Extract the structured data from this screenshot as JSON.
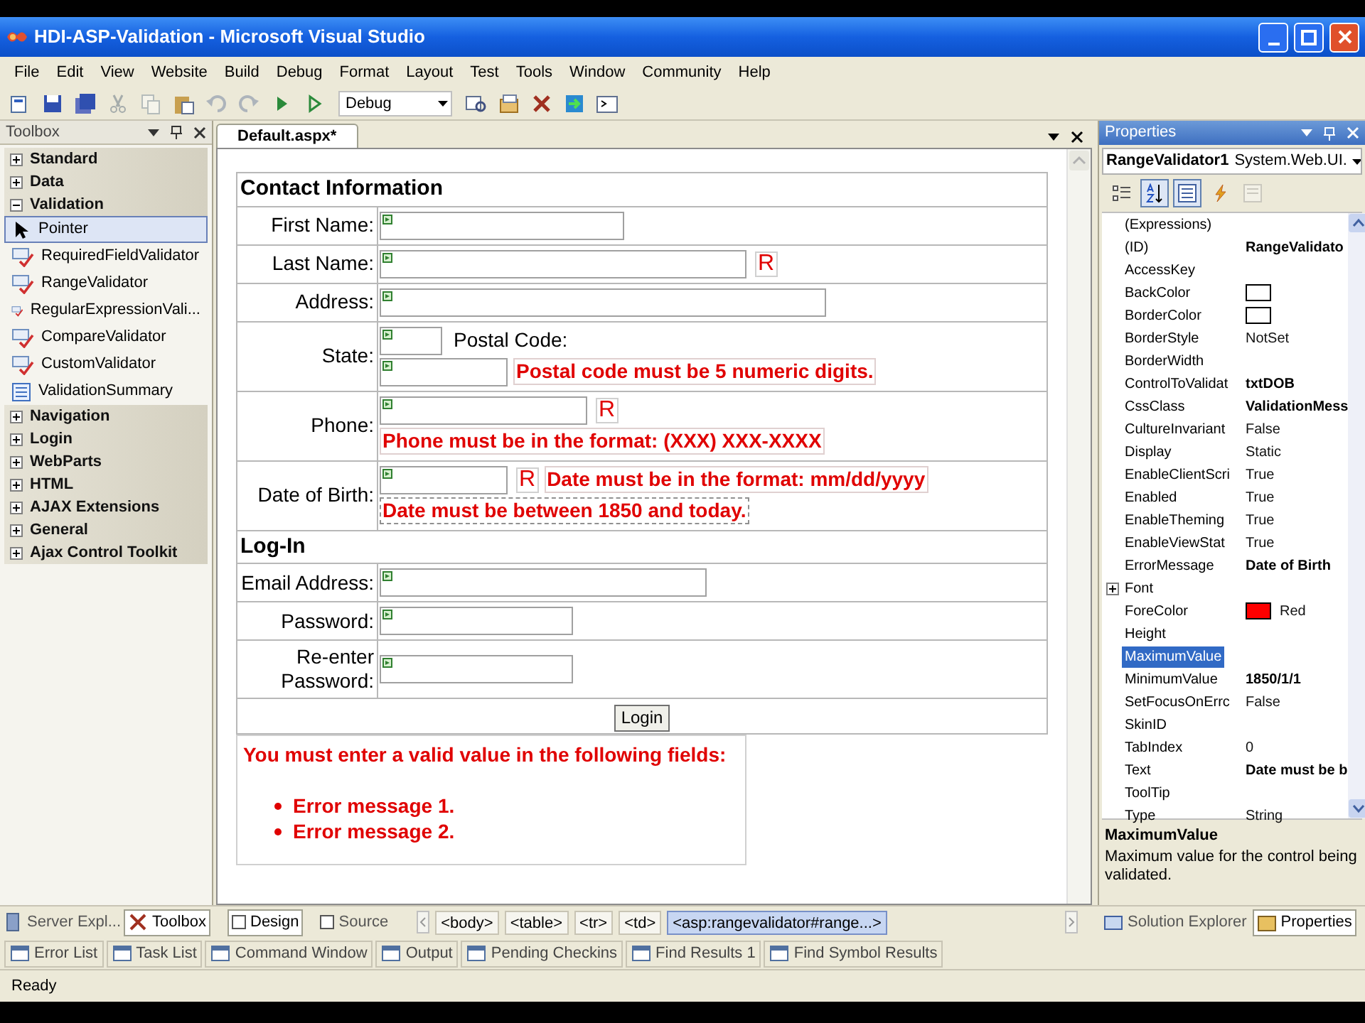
{
  "window": {
    "title": "HDI-ASP-Validation - Microsoft Visual Studio"
  },
  "menu": [
    "File",
    "Edit",
    "View",
    "Website",
    "Build",
    "Debug",
    "Format",
    "Layout",
    "Test",
    "Tools",
    "Window",
    "Community",
    "Help"
  ],
  "toolbar": {
    "configuration": "Debug"
  },
  "toolbox": {
    "title": "Toolbox",
    "categories": [
      {
        "label": "Standard",
        "expanded": false
      },
      {
        "label": "Data",
        "expanded": false
      },
      {
        "label": "Validation",
        "expanded": true,
        "items": [
          {
            "label": "Pointer",
            "kind": "pointer",
            "selected": true
          },
          {
            "label": "RequiredFieldValidator",
            "kind": "validator",
            "selected": false
          },
          {
            "label": "RangeValidator",
            "kind": "validator",
            "selected": false
          },
          {
            "label": "RegularExpressionVali...",
            "kind": "validator",
            "selected": false
          },
          {
            "label": "CompareValidator",
            "kind": "validator",
            "selected": false
          },
          {
            "label": "CustomValidator",
            "kind": "validator",
            "selected": false
          },
          {
            "label": "ValidationSummary",
            "kind": "summary",
            "selected": false
          }
        ]
      },
      {
        "label": "Navigation",
        "expanded": false
      },
      {
        "label": "Login",
        "expanded": false
      },
      {
        "label": "WebParts",
        "expanded": false
      },
      {
        "label": "HTML",
        "expanded": false
      },
      {
        "label": "AJAX Extensions",
        "expanded": false
      },
      {
        "label": "General",
        "expanded": false
      },
      {
        "label": "Ajax Control Toolkit",
        "expanded": false
      }
    ]
  },
  "document": {
    "tab": "Default.aspx*",
    "sections": [
      {
        "heading": "Contact Information",
        "rows": [
          {
            "label": "First Name:",
            "lines": [
              [
                {
                  "kind": "textbox"
                }
              ]
            ]
          },
          {
            "label": "Last Name:",
            "lines": [
              [
                {
                  "kind": "textbox"
                },
                {
                  "kind": "required",
                  "text": "R"
                }
              ]
            ]
          },
          {
            "label": "Address:",
            "lines": [
              [
                {
                  "kind": "textbox"
                }
              ]
            ]
          },
          {
            "label": "State:",
            "lines": [
              [
                {
                  "kind": "textbox"
                },
                {
                  "kind": "text",
                  "text": "Postal Code:"
                }
              ],
              [
                {
                  "kind": "textbox"
                },
                {
                  "kind": "message",
                  "text": "Postal code must be 5 numeric digits.",
                  "selected": false
                }
              ]
            ]
          },
          {
            "label": "Phone:",
            "lines": [
              [
                {
                  "kind": "textbox"
                },
                {
                  "kind": "required",
                  "text": "R"
                }
              ],
              [
                {
                  "kind": "message",
                  "text": "Phone must be in the format: (XXX) XXX-XXXX",
                  "selected": false
                }
              ]
            ]
          },
          {
            "label": "Date of Birth:",
            "lines": [
              [
                {
                  "kind": "textbox"
                },
                {
                  "kind": "required",
                  "text": "R"
                },
                {
                  "kind": "message",
                  "text": "Date must be in the format: mm/dd/yyyy",
                  "selected": false
                }
              ],
              [
                {
                  "kind": "message",
                  "text": "Date must be between 1850 and today.",
                  "selected": true
                }
              ]
            ]
          }
        ]
      },
      {
        "heading": "Log-In",
        "rows": [
          {
            "label": "Email Address:",
            "lines": [
              [
                {
                  "kind": "textbox"
                }
              ]
            ]
          },
          {
            "label": "Password:",
            "lines": [
              [
                {
                  "kind": "textbox"
                }
              ]
            ]
          },
          {
            "label": "Re-enter Password:",
            "lines": [
              [
                {
                  "kind": "textbox"
                }
              ]
            ]
          }
        ]
      }
    ],
    "button": "Login",
    "summary": {
      "title": "You must enter a valid value in the following fields:",
      "items": [
        "Error message 1.",
        "Error message 2."
      ]
    }
  },
  "designer_tabs": [
    {
      "label": "Design",
      "selected": true
    },
    {
      "label": "Source",
      "selected": false
    }
  ],
  "breadcrumbs": [
    {
      "label": "<body>",
      "selected": false
    },
    {
      "label": "<table>",
      "selected": false
    },
    {
      "label": "<tr>",
      "selected": false
    },
    {
      "label": "<td>",
      "selected": false
    },
    {
      "label": "<asp:rangevalidator#range...>",
      "selected": true
    }
  ],
  "left_tabs": [
    {
      "label": "Server Expl...",
      "selected": false
    },
    {
      "label": "Toolbox",
      "selected": true
    }
  ],
  "right_tabs": [
    {
      "label": "Solution Explorer",
      "selected": false
    },
    {
      "label": "Properties",
      "selected": true
    }
  ],
  "tool_windows": [
    "Error List",
    "Task List",
    "Command Window",
    "Output",
    "Pending Checkins",
    "Find Results 1",
    "Find Symbol Results"
  ],
  "properties": {
    "title": "Properties",
    "object": "RangeValidator1",
    "type": "System.Web.UI.",
    "rows": [
      {
        "name": "(Expressions)",
        "selected": false
      },
      {
        "name": "(ID)",
        "value": "RangeValidato",
        "selected": false,
        "modified": true
      },
      {
        "name": "AccessKey",
        "selected": false
      },
      {
        "name": "BackColor",
        "color": "#ffffff",
        "selected": false
      },
      {
        "name": "BorderColor",
        "color": "#ffffff",
        "selected": false
      },
      {
        "name": "BorderStyle",
        "value": "NotSet",
        "selected": false,
        "modified": false
      },
      {
        "name": "BorderWidth",
        "selected": false
      },
      {
        "name": "ControlToValidat",
        "value": "txtDOB",
        "selected": false,
        "modified": true
      },
      {
        "name": "CssClass",
        "value": "ValidationMess",
        "selected": false,
        "modified": true
      },
      {
        "name": "CultureInvariant",
        "value": "False",
        "selected": false,
        "modified": false
      },
      {
        "name": "Display",
        "value": "Static",
        "selected": false,
        "modified": false
      },
      {
        "name": "EnableClientScri",
        "value": "True",
        "selected": false,
        "modified": false
      },
      {
        "name": "Enabled",
        "value": "True",
        "selected": false,
        "modified": false
      },
      {
        "name": "EnableTheming",
        "value": "True",
        "selected": false,
        "modified": false
      },
      {
        "name": "EnableViewStat",
        "value": "True",
        "selected": false,
        "modified": false
      },
      {
        "name": "ErrorMessage",
        "value": "Date of Birth",
        "selected": false,
        "modified": true
      },
      {
        "name": "Font",
        "expanded": false,
        "selected": false
      },
      {
        "name": "ForeColor",
        "color": "#ff0000",
        "value": "Red",
        "selected": false,
        "modified": false
      },
      {
        "name": "Height",
        "selected": false
      },
      {
        "name": "MaximumValue",
        "selected": true
      },
      {
        "name": "MinimumValue",
        "value": "1850/1/1",
        "selected": false,
        "modified": true
      },
      {
        "name": "SetFocusOnErrc",
        "value": "False",
        "selected": false,
        "modified": false
      },
      {
        "name": "SkinID",
        "selected": false
      },
      {
        "name": "TabIndex",
        "value": "0",
        "selected": false,
        "modified": false
      },
      {
        "name": "Text",
        "value": "Date must be b",
        "selected": false,
        "modified": true
      },
      {
        "name": "ToolTip",
        "selected": false
      },
      {
        "name": "Type",
        "value": "String",
        "selected": false,
        "modified": false
      }
    ],
    "description": {
      "title": "MaximumValue",
      "text": "Maximum value for the control being validated."
    }
  },
  "status_bar": "Ready"
}
